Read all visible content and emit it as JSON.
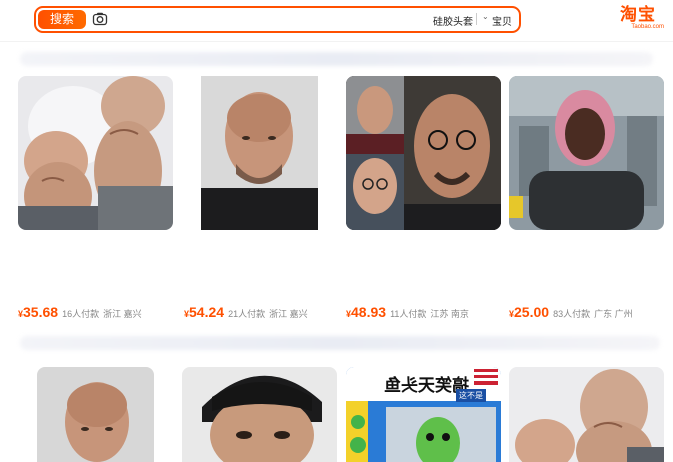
{
  "header": {
    "search_button": "搜索",
    "query": "硅胶头套",
    "scope": "宝贝",
    "logo_text": "淘宝",
    "logo_sub": "Taobao.com",
    "accent": "#ff5000"
  },
  "products": [
    {
      "currency": "¥",
      "price": "35.68",
      "sold": "16人付款",
      "location": "浙江 嘉兴"
    },
    {
      "currency": "¥",
      "price": "54.24",
      "sold": "21人付款",
      "location": "浙江 嘉兴"
    },
    {
      "currency": "¥",
      "price": "48.93",
      "sold": "11人付款",
      "location": "江苏 南京"
    },
    {
      "currency": "¥",
      "price": "25.00",
      "sold": "83人付款",
      "location": "广东 广州"
    }
  ],
  "promo_banner": {
    "headline": "搞笑天头鱼",
    "tag": "这不是"
  }
}
